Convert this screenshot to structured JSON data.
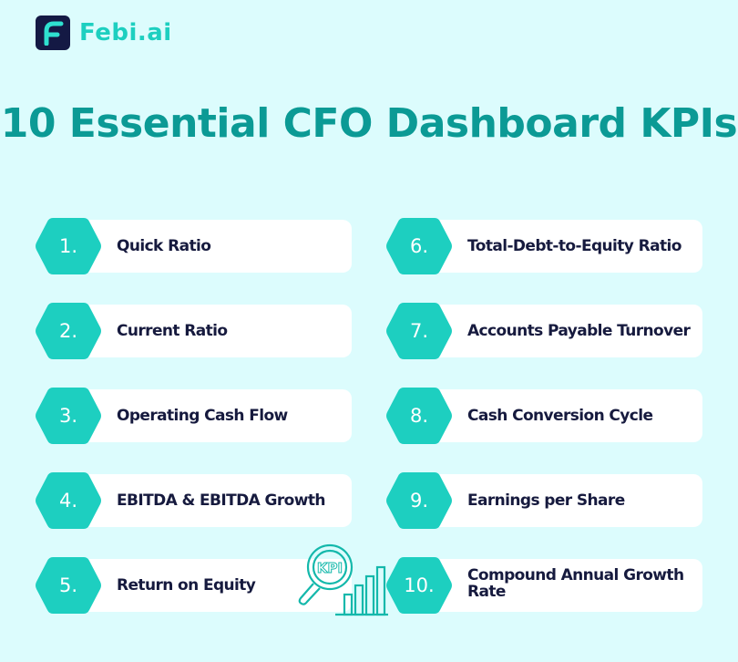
{
  "brand": {
    "name": "Febi.ai",
    "icon": "febi-logo-icon"
  },
  "title": "10 Essential CFO Dashboard KPIs",
  "colors": {
    "background": "#dcfcfd",
    "accent": "#1dcfc0",
    "title": "#0b9a95",
    "text": "#161a3e",
    "card": "#ffffff",
    "logo_bg": "#141944"
  },
  "kpis": [
    {
      "number": "1.",
      "label": "Quick Ratio"
    },
    {
      "number": "2.",
      "label": "Current Ratio"
    },
    {
      "number": "3.",
      "label": "Operating Cash Flow"
    },
    {
      "number": "4.",
      "label": "EBITDA & EBITDA Growth"
    },
    {
      "number": "5.",
      "label": "Return on Equity"
    },
    {
      "number": "6.",
      "label": "Total-Debt-to-Equity Ratio"
    },
    {
      "number": "7.",
      "label": "Accounts Payable Turnover"
    },
    {
      "number": "8.",
      "label": "Cash Conversion Cycle"
    },
    {
      "number": "9.",
      "label": "Earnings per Share"
    },
    {
      "number": "10.",
      "label": "Compound Annual Growth Rate"
    }
  ],
  "illustration": {
    "icon": "kpi-magnifier-chart-icon",
    "text": "KPI"
  }
}
